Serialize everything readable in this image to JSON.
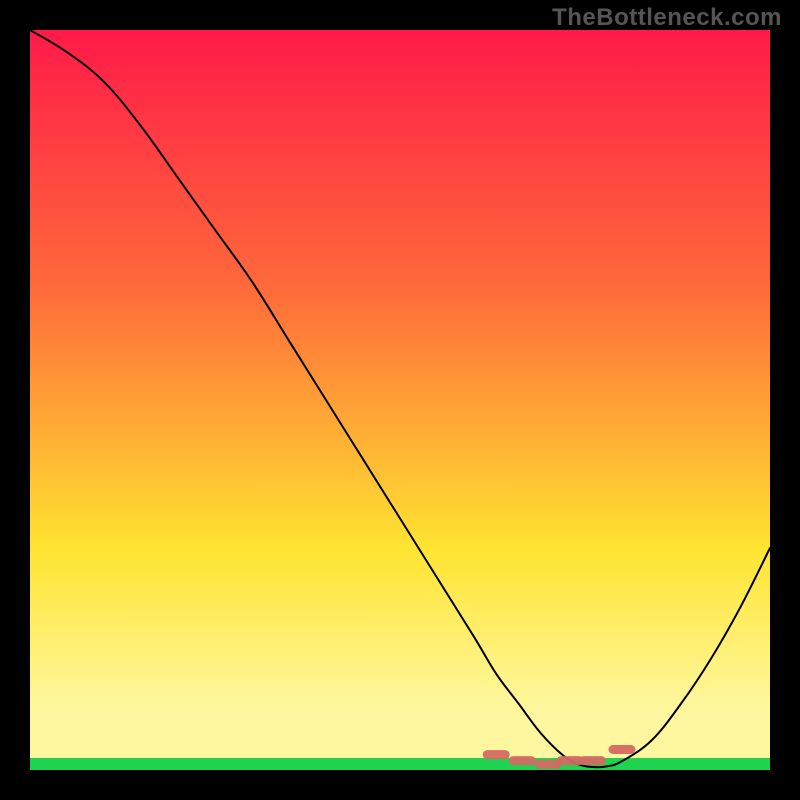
{
  "watermark": "TheBottleneck.com",
  "chart_data": {
    "type": "line",
    "title": "",
    "xlabel": "",
    "ylabel": "",
    "xlim": [
      0,
      100
    ],
    "ylim": [
      0,
      100
    ],
    "background_gradient": {
      "top": "#ff1a49",
      "mid1": "#ff6a3a",
      "mid2": "#ffe431",
      "bottom_band": "#fff7a0",
      "floor": "#1fd24f"
    },
    "series": [
      {
        "name": "bottleneck-curve",
        "stroke": "#000000",
        "stroke_width": 2,
        "x": [
          0,
          5,
          10,
          15,
          20,
          25,
          30,
          35,
          40,
          45,
          50,
          55,
          60,
          63,
          66,
          69,
          72,
          74,
          76,
          78,
          80,
          84,
          88,
          92,
          96,
          100
        ],
        "values": [
          100,
          97,
          93,
          87,
          80,
          73,
          66,
          58,
          50,
          42,
          34,
          26,
          18,
          13,
          9,
          5,
          2,
          0.8,
          0.4,
          0.5,
          1.2,
          4,
          9,
          15,
          22,
          30
        ]
      }
    ],
    "markers": {
      "name": "recommended-range",
      "color": "#d46a62",
      "shape": "capsule",
      "x": [
        63,
        66.5,
        70,
        73,
        76,
        80
      ],
      "y": [
        1.8,
        1.0,
        0.5,
        1.0,
        1.0,
        2.5
      ]
    }
  }
}
